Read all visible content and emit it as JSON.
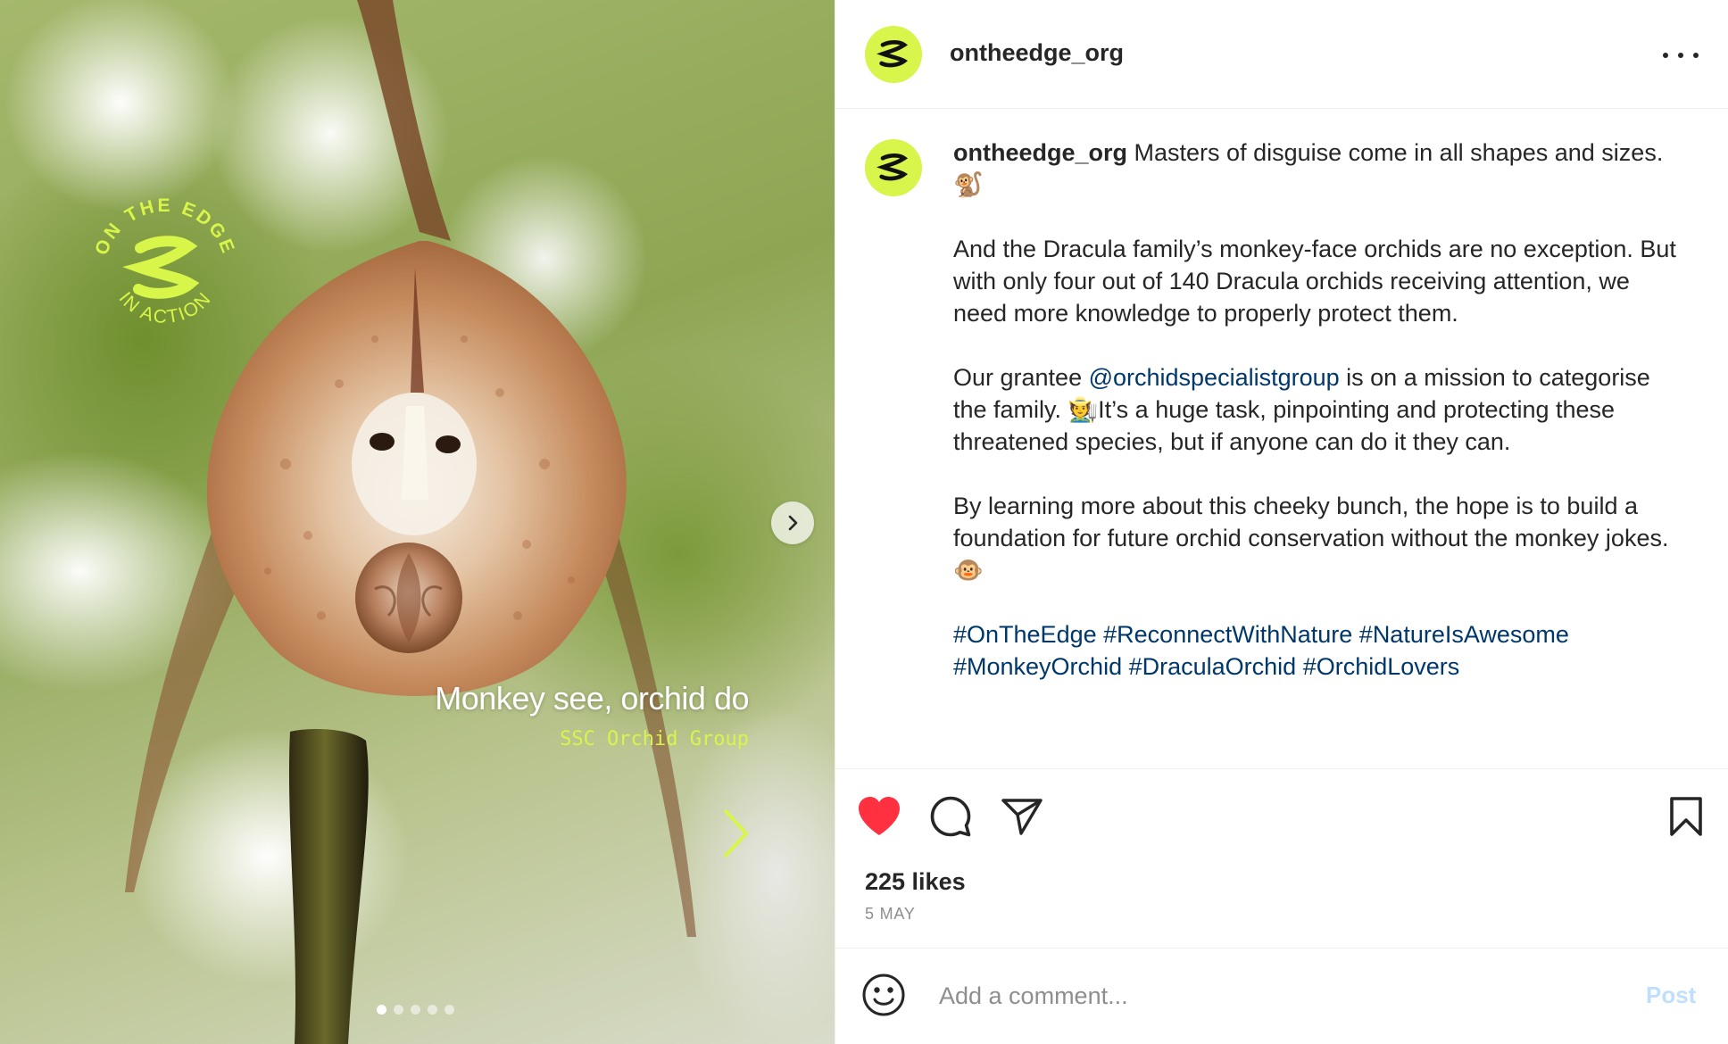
{
  "media": {
    "badge": {
      "top_text": "ON THE EDGE",
      "bottom_text": "IN ACTION",
      "logo": "z-wave-logo"
    },
    "caption_title": "Monkey see, orchid do",
    "caption_subtitle": "SSC Orchid Group",
    "carousel": {
      "slide_count": 5,
      "active_index": 0
    },
    "colors": {
      "accent": "#d8f54a"
    }
  },
  "header": {
    "username": "ontheedge_org",
    "more_icon": "more-horizontal-icon"
  },
  "post": {
    "username": "ontheedge_org",
    "caption_intro": "Masters of disguise come in all shapes and sizes. 🐒",
    "paragraph_2": "And the Dracula family’s monkey-face orchids are no exception. But with only four out of 140 Dracula orchids receiving attention, we need more knowledge to properly protect them.",
    "paragraph_3_before": "Our grantee ",
    "mention": "@orchidspecialistgroup",
    "paragraph_3_after": " is on a mission to categorise the family. 🧑‍🌾It’s a huge task, pinpointing and protecting these threatened species, but if anyone can do it they can.",
    "paragraph_4": "By learning more about this cheeky bunch, the hope is to build a foundation for future orchid conservation without the monkey jokes. 🐵",
    "hashtags": [
      "#OnTheEdge",
      "#ReconnectWithNature",
      "#NatureIsAwesome",
      "#MonkeyOrchid",
      "#DraculaOrchid",
      "#OrchidLovers"
    ]
  },
  "actions": {
    "like_icon": "heart-filled-icon",
    "comment_icon": "comment-icon",
    "share_icon": "paper-plane-icon",
    "save_icon": "bookmark-icon",
    "liked": true,
    "like_color": "#ff3040"
  },
  "likes": "225 likes",
  "date": "5 MAY",
  "add_comment": {
    "placeholder": "Add a comment...",
    "post_label": "Post",
    "emoji_icon": "smiley-icon"
  }
}
